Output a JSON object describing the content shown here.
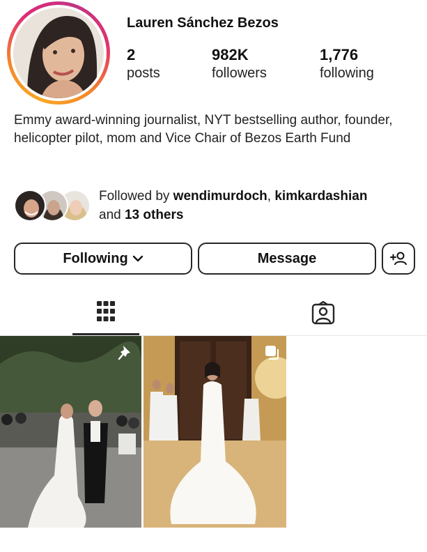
{
  "profile": {
    "username": "Lauren Sánchez Bezos",
    "stats": [
      {
        "value": "2",
        "label": "posts"
      },
      {
        "value": "982K",
        "label": "followers"
      },
      {
        "value": "1,776",
        "label": "following"
      }
    ],
    "bio": "Emmy award-winning journalist, NYT bestselling author, founder, helicopter pilot, mom and Vice Chair of Bezos Earth Fund"
  },
  "followed_by": {
    "prefix": "Followed by ",
    "user1": "wendimurdoch",
    "separator": ", ",
    "user2": "kimkardashian",
    "and": " and ",
    "others": "13 others"
  },
  "actions": {
    "following_label": "Following",
    "message_label": "Message",
    "add_person_icon": "add-person-icon"
  },
  "tabs": [
    {
      "name": "grid",
      "icon": "grid-icon",
      "active": true
    },
    {
      "name": "tagged",
      "icon": "tagged-icon",
      "active": false
    }
  ],
  "posts": [
    {
      "icon": "pin-icon",
      "description": "wedding photo outdoors"
    },
    {
      "icon": "carousel-icon",
      "description": "bride in lace gown indoors"
    }
  ],
  "colors": {
    "text": "#262626",
    "ring_start": "#f9a825",
    "ring_end": "#dd2a7b"
  }
}
